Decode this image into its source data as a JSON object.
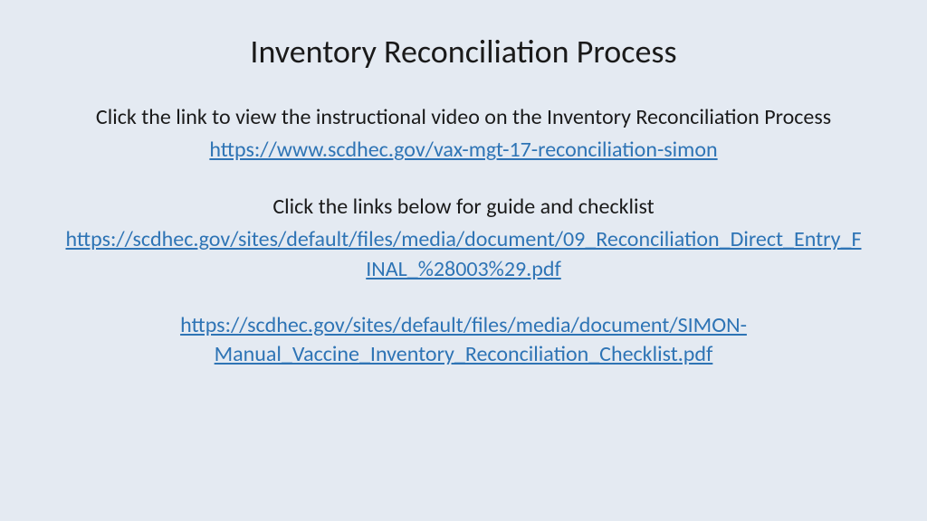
{
  "title": "Inventory Reconciliation Process",
  "intro1": "Click the link to view the instructional video on the Inventory Reconciliation Process",
  "link1": "https://www.scdhec.gov/vax-mgt-17-reconciliation-simon",
  "intro2": "Click the links below for guide and checklist",
  "link2": "https://scdhec.gov/sites/default/files/media/document/09_Reconciliation_Direct_Entry_FINAL_%28003%29.pdf",
  "link3": "https://scdhec.gov/sites/default/files/media/document/SIMON-Manual_Vaccine_Inventory_Reconciliation_Checklist.pdf"
}
